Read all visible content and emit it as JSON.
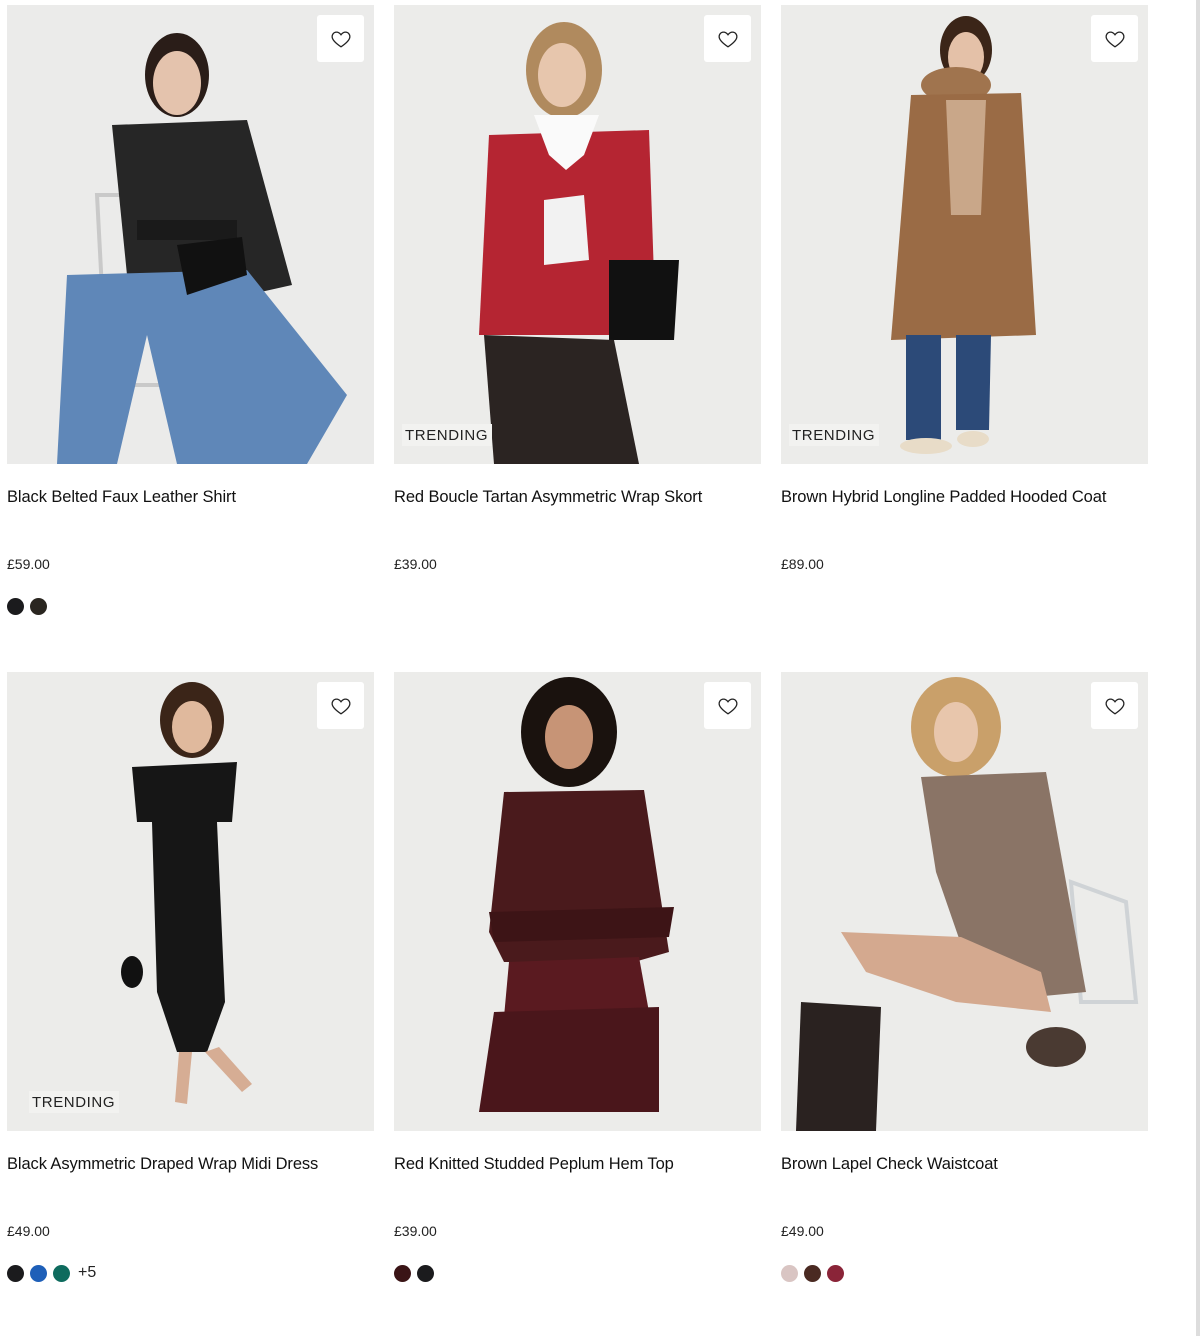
{
  "products": [
    {
      "name": "Black Belted Faux Leather Shirt",
      "price": "£59.00",
      "badge": "",
      "swatches": [
        "#1b1b1d",
        "#2a2620"
      ],
      "more": "",
      "bg": "#ebebea",
      "top": "#262626",
      "bottom": "#5f87b8",
      "hair": "#2a1d18"
    },
    {
      "name": "Red Boucle Tartan Asymmetric Wrap Skort",
      "price": "£39.00",
      "badge": "TRENDING",
      "swatches": [],
      "more": "",
      "bg": "#ececea",
      "top": "#b52532",
      "bottom": "#b52532",
      "hair": "#b08a5e"
    },
    {
      "name": "Brown Hybrid Longline Padded Hooded Coat",
      "price": "£89.00",
      "badge": "TRENDING",
      "swatches": [],
      "more": "",
      "bg": "#ececea",
      "top": "#9a6b45",
      "bottom": "#2c4a78",
      "hair": "#3b2518"
    },
    {
      "name": "Black Asymmetric Draped Wrap Midi Dress",
      "price": "£49.00",
      "badge": "TRENDING",
      "swatches": [
        "#1b1b1d",
        "#1e5fb8",
        "#0e6b5e"
      ],
      "more": "+5",
      "bg": "#ececea",
      "top": "#161616",
      "bottom": "#161616",
      "hair": "#3b2518"
    },
    {
      "name": "Red Knitted Studded Peplum Hem Top",
      "price": "£39.00",
      "badge": "",
      "swatches": [
        "#3a1416",
        "#1b1b1d"
      ],
      "more": "",
      "bg": "#ececea",
      "top": "#4a1a1c",
      "bottom": "#5a1a20",
      "hair": "#1a120e"
    },
    {
      "name": "Brown Lapel Check Waistcoat",
      "price": "£49.00",
      "badge": "",
      "swatches": [
        "#d9c5c3",
        "#4a2a22",
        "#8a2438"
      ],
      "more": "",
      "bg": "#ececea",
      "top": "#8a7466",
      "bottom": "#2a2220",
      "hair": "#c9a06a"
    }
  ],
  "icons": {
    "wishlist": "heart-outline-icon"
  }
}
